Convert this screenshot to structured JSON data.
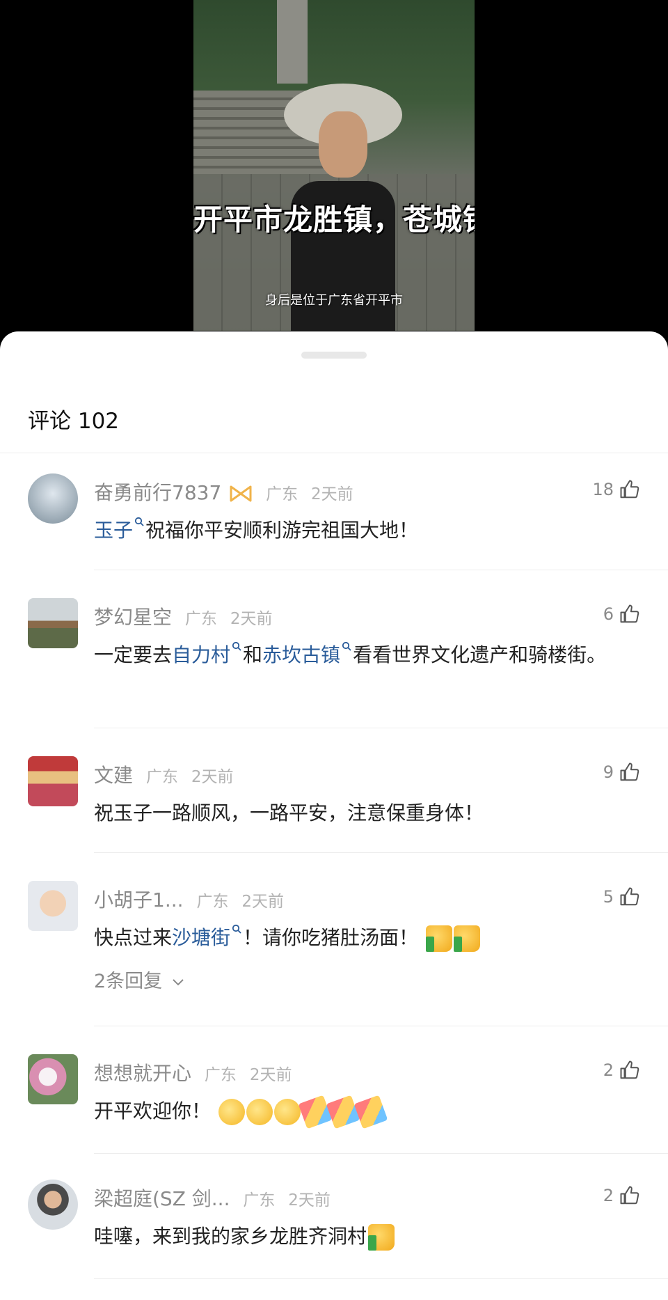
{
  "video": {
    "caption_big": "开平市龙胜镇，苍城镇",
    "caption_small": "身后是位于广东省开平市"
  },
  "sheet": {
    "title": "评论 102"
  },
  "comments": [
    {
      "name": "奋勇前行7837",
      "location": "广东",
      "time": "2天前",
      "likes": "18",
      "text_parts": [
        "玉子",
        "祝福你平安顺利游完祖国大地！"
      ]
    },
    {
      "name": "梦幻星空",
      "location": "广东",
      "time": "2天前",
      "likes": "6",
      "text_parts": [
        "一定要去",
        "自力村",
        "和",
        "赤坎古镇",
        "看看世界文化遗产和骑楼街。"
      ]
    },
    {
      "name": "文建",
      "location": "广东",
      "time": "2天前",
      "likes": "9",
      "text_parts": [
        "祝玉子一路顺风，一路平安，注意保重身体！"
      ]
    },
    {
      "name": "小胡子1...",
      "location": "广东",
      "time": "2天前",
      "likes": "5",
      "text_parts": [
        "快点过来",
        "沙塘街",
        "！请你吃猪肚汤面！"
      ],
      "replies": "2条回复"
    },
    {
      "name": "想想就开心",
      "location": "广东",
      "time": "2天前",
      "likes": "2",
      "text_parts": [
        "开平欢迎你！"
      ]
    },
    {
      "name": "梁超庭(SZ 剑...",
      "location": "广东",
      "time": "2天前",
      "likes": "2",
      "text_parts": [
        "哇噻，来到我的家乡龙胜齐洞村"
      ]
    }
  ],
  "icons": {
    "like": "thumb-up-icon",
    "search": "magnifier-icon",
    "badge": "ribbon-badge-icon",
    "expand": "chevron-down-icon"
  },
  "colors": {
    "link": "#2a5c9a",
    "name": "#8a8a8a",
    "text": "#222222",
    "badge": "#f0b34a"
  }
}
